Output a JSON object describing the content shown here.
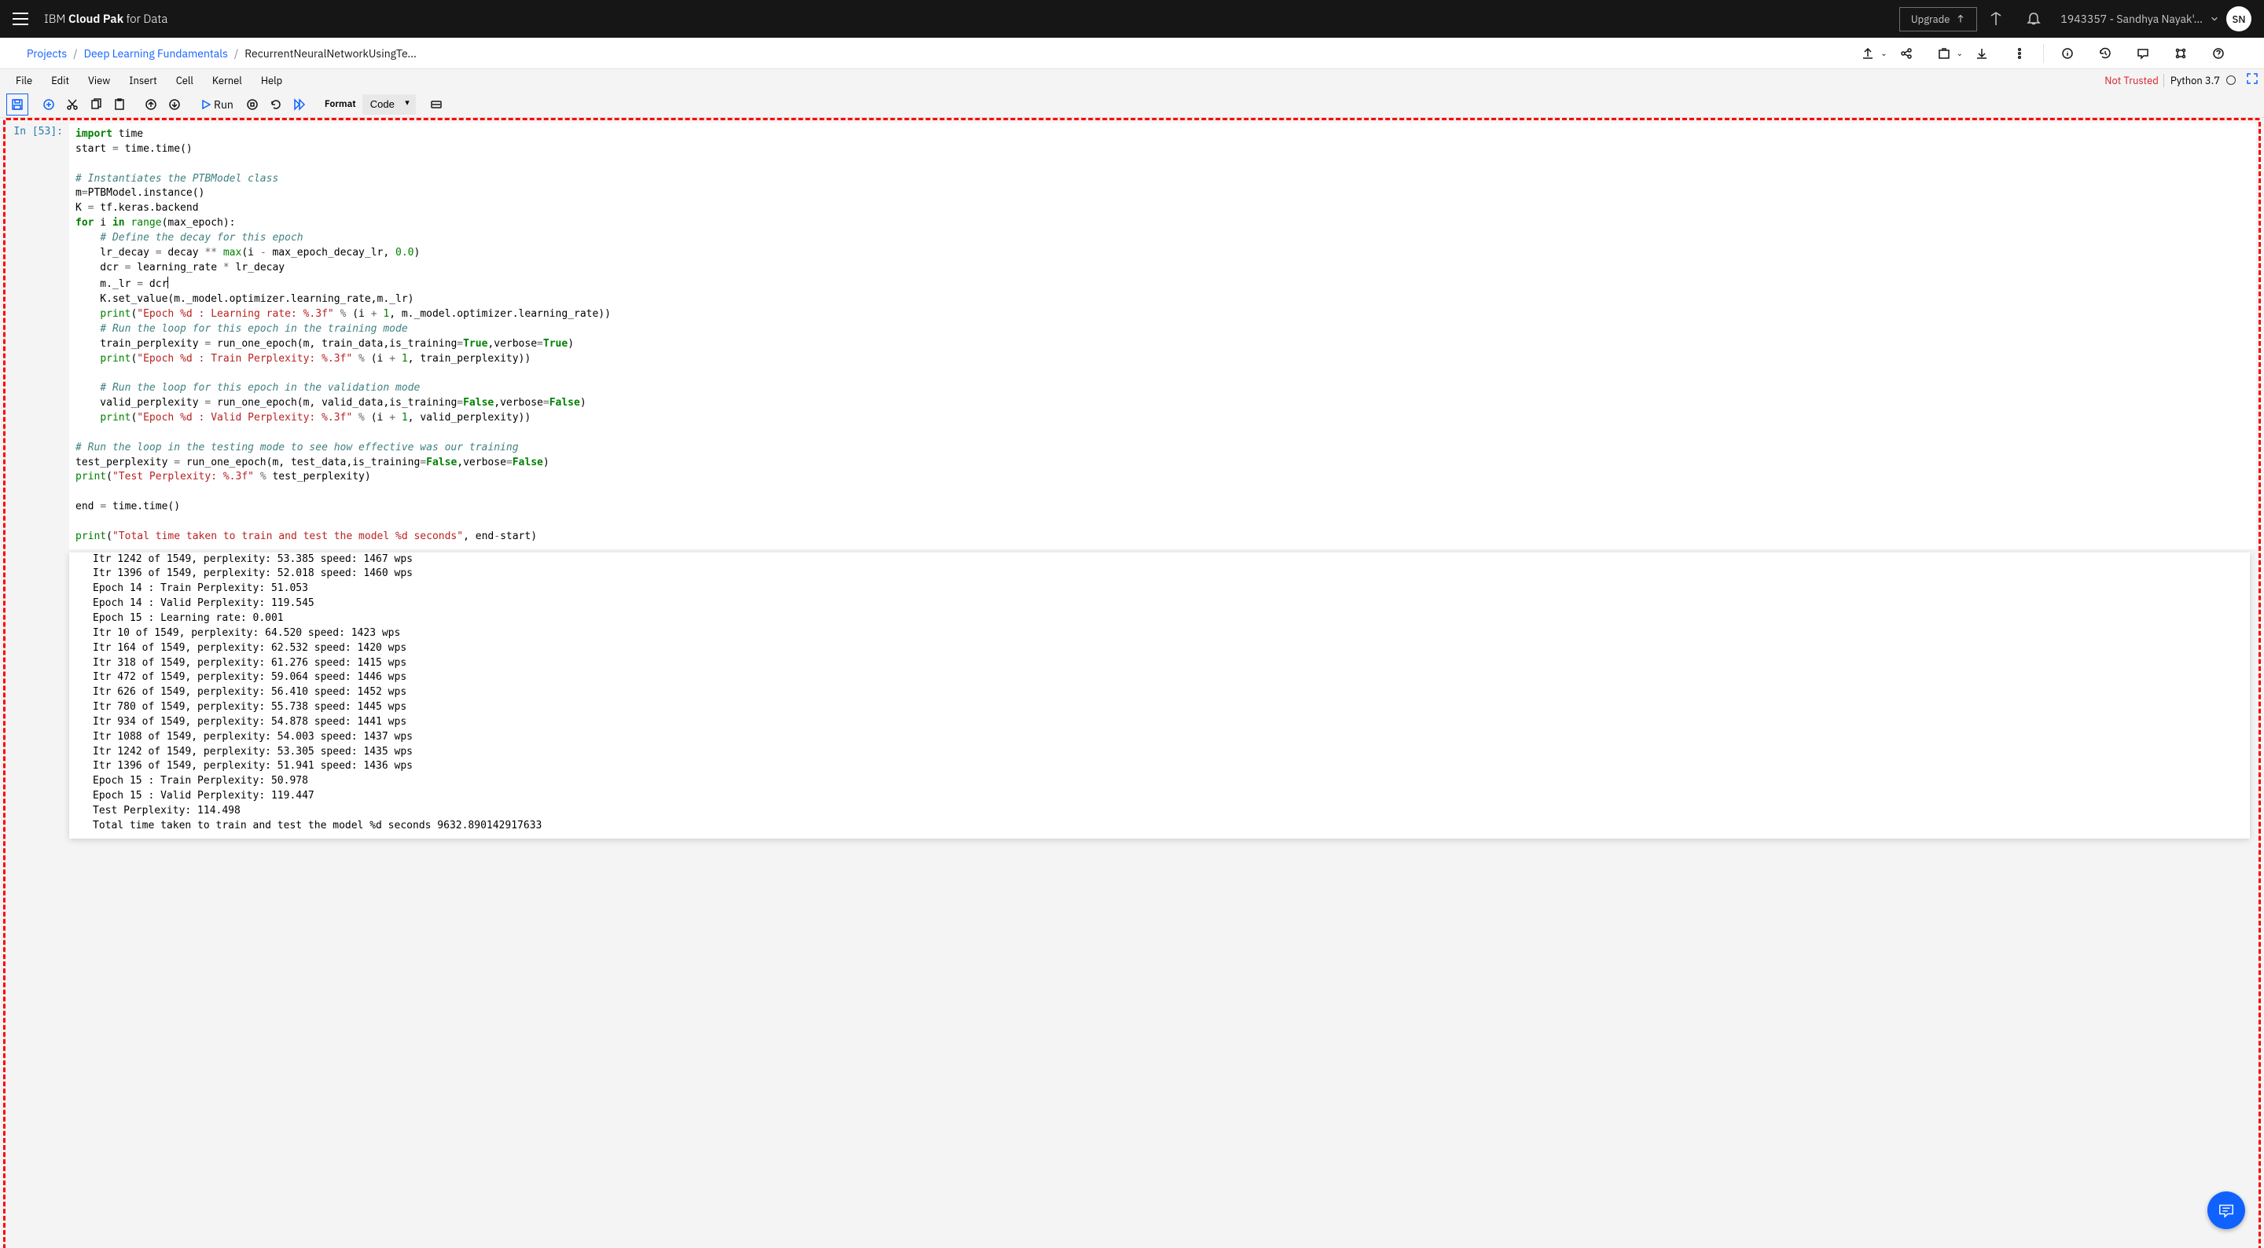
{
  "header": {
    "brand_prefix": "IBM ",
    "brand_bold": "Cloud Pak ",
    "brand_suffix": "for Data",
    "upgrade": "Upgrade",
    "user_label": "1943357 - Sandhya Nayak'...",
    "avatar": "SN"
  },
  "breadcrumb": {
    "items": [
      "Projects",
      "Deep Learning Fundamentals",
      "RecurrentNeuralNetworkUsingTe..."
    ]
  },
  "menu": {
    "items": [
      "File",
      "Edit",
      "View",
      "Insert",
      "Cell",
      "Kernel",
      "Help"
    ],
    "trust": "Not Trusted",
    "kernel": "Python 3.7"
  },
  "toolbar": {
    "run": "Run",
    "format_label": "Format",
    "cell_type": "Code"
  },
  "cell": {
    "prompt": "In [53]:",
    "cursor_text_col": "m._lr = dcr"
  },
  "output_lines": [
    "Itr 1242 of 1549, perplexity: 53.385 speed: 1467 wps",
    "Itr 1396 of 1549, perplexity: 52.018 speed: 1460 wps",
    "Epoch 14 : Train Perplexity: 51.053",
    "Epoch 14 : Valid Perplexity: 119.545",
    "Epoch 15 : Learning rate: 0.001",
    "Itr 10 of 1549, perplexity: 64.520 speed: 1423 wps",
    "Itr 164 of 1549, perplexity: 62.532 speed: 1420 wps",
    "Itr 318 of 1549, perplexity: 61.276 speed: 1415 wps",
    "Itr 472 of 1549, perplexity: 59.064 speed: 1446 wps",
    "Itr 626 of 1549, perplexity: 56.410 speed: 1452 wps",
    "Itr 780 of 1549, perplexity: 55.738 speed: 1445 wps",
    "Itr 934 of 1549, perplexity: 54.878 speed: 1441 wps",
    "Itr 1088 of 1549, perplexity: 54.003 speed: 1437 wps",
    "Itr 1242 of 1549, perplexity: 53.305 speed: 1435 wps",
    "Itr 1396 of 1549, perplexity: 51.941 speed: 1436 wps",
    "Epoch 15 : Train Perplexity: 50.978",
    "Epoch 15 : Valid Perplexity: 119.447",
    "Test Perplexity: 114.498",
    "Total time taken to train and test the model %d seconds 9632.890142917633"
  ]
}
